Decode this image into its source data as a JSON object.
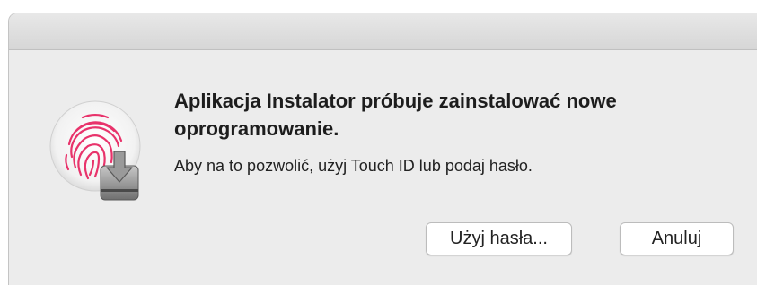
{
  "dialog": {
    "title": "Aplikacja Instalator próbuje zainstalować nowe oprogramowanie.",
    "message": "Aby na to pozwolić, użyj Touch ID lub podaj hasło.",
    "icon": "touch-id-fingerprint-with-installer-icon",
    "buttons": {
      "use_password": "Użyj hasła...",
      "cancel": "Anuluj"
    }
  },
  "colors": {
    "fingerprint": "#e8336b",
    "window_background": "#ececec"
  }
}
